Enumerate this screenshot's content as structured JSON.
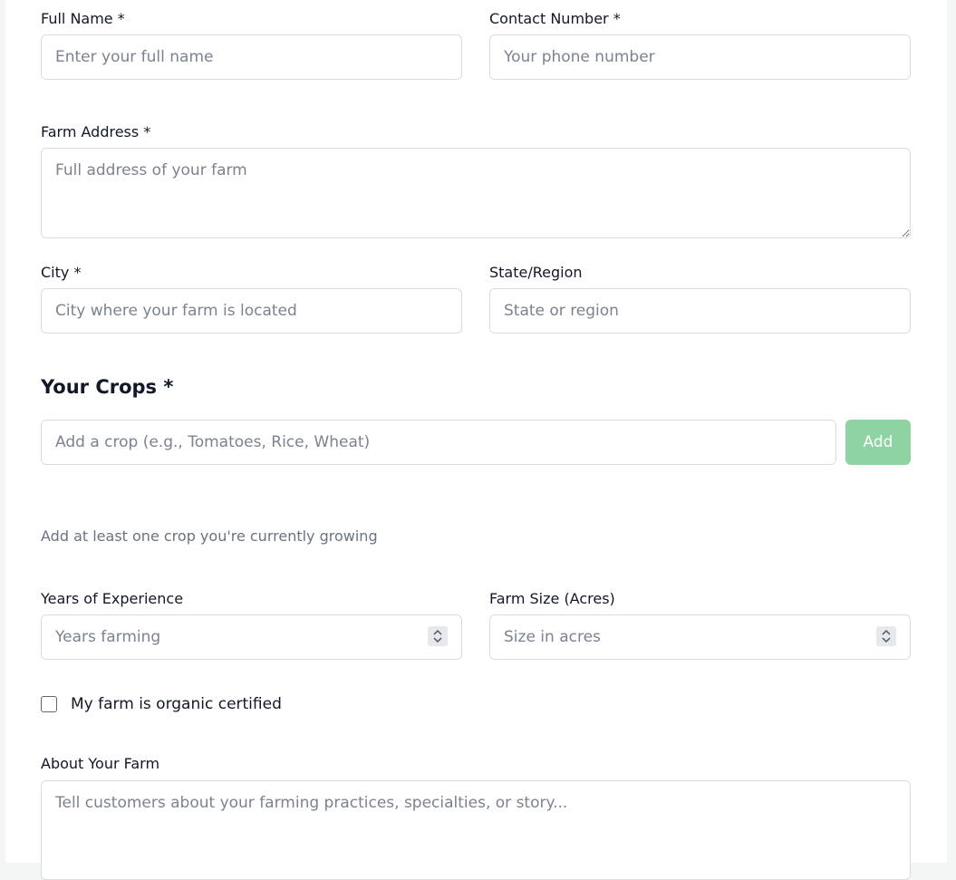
{
  "form": {
    "full_name": {
      "label": "Full Name *",
      "placeholder": "Enter your full name",
      "value": ""
    },
    "contact_number": {
      "label": "Contact Number *",
      "placeholder": "Your phone number",
      "value": ""
    },
    "farm_address": {
      "label": "Farm Address *",
      "placeholder": "Full address of your farm",
      "value": ""
    },
    "city": {
      "label": "City *",
      "placeholder": "City where your farm is located",
      "value": ""
    },
    "state_region": {
      "label": "State/Region",
      "placeholder": "State or region",
      "value": ""
    },
    "crops": {
      "title": "Your Crops *",
      "input_placeholder": "Add a crop (e.g., Tomatoes, Rice, Wheat)",
      "add_label": "Add",
      "hint": "Add at least one crop you're currently growing"
    },
    "years_experience": {
      "label": "Years of Experience",
      "placeholder": "Years farming",
      "value": ""
    },
    "farm_size": {
      "label": "Farm Size (Acres)",
      "placeholder": "Size in acres",
      "value": ""
    },
    "organic": {
      "label": "My farm is organic certified",
      "checked": false
    },
    "about": {
      "label": "About Your Farm",
      "placeholder": "Tell customers about your farming practices, specialties, or story..."
    }
  },
  "colors": {
    "accent": "#8ed3a2",
    "border": "#d9dde3",
    "placeholder": "#7b8290"
  }
}
